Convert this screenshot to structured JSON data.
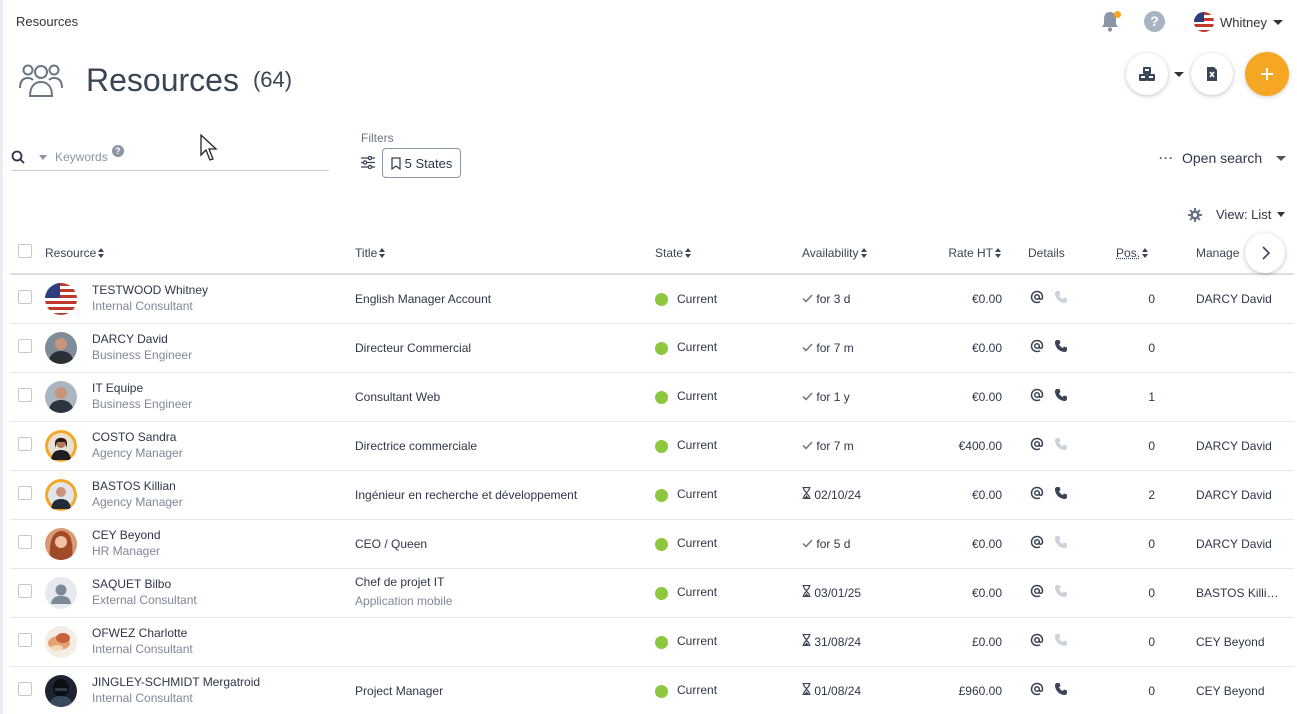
{
  "breadcrumb": "Resources",
  "user": {
    "name": "Whitney"
  },
  "page": {
    "title": "Resources",
    "count": "(64)"
  },
  "search": {
    "placeholder": "Keywords"
  },
  "filters": {
    "label": "Filters",
    "states_label": "5 States"
  },
  "open_search": "Open search",
  "view": {
    "label": "View: List"
  },
  "colors": {
    "accent": "#f5a623",
    "state_current": "#8dc63f"
  },
  "columns": [
    "Resource",
    "Title",
    "State",
    "Availability",
    "Rate HT",
    "Details",
    "Pos.",
    "Manage"
  ],
  "rows": [
    {
      "name": "TESTWOOD Whitney",
      "role": "Internal Consultant",
      "title": "English Manager Account",
      "title_sub": "",
      "state": "Current",
      "avail": "for 3 d",
      "avail_icon": "check-icon",
      "rate": "€0.00",
      "phone": false,
      "pos": "0",
      "manager": "DARCY David",
      "avatar": "flag"
    },
    {
      "name": "DARCY David",
      "role": "Business Engineer",
      "title": "Directeur Commercial",
      "title_sub": "",
      "state": "Current",
      "avail": "for 7 m",
      "avail_icon": "check-icon",
      "rate": "€0.00",
      "phone": true,
      "pos": "0",
      "manager": "",
      "avatar": "man-dark"
    },
    {
      "name": "IT Equipe",
      "role": "Business Engineer",
      "title": "Consultant Web",
      "title_sub": "",
      "state": "Current",
      "avail": "for 1 y",
      "avail_icon": "check-icon",
      "rate": "€0.00",
      "phone": true,
      "pos": "1",
      "manager": "",
      "avatar": "man-grey"
    },
    {
      "name": "COSTO Sandra",
      "role": "Agency Manager",
      "title": "Directrice commerciale",
      "title_sub": "",
      "state": "Current",
      "avail": "for 7 m",
      "avail_icon": "check-icon",
      "rate": "€400.00",
      "phone": false,
      "pos": "0",
      "manager": "DARCY David",
      "avatar": "woman-ring"
    },
    {
      "name": "BASTOS Killian",
      "role": "Agency Manager",
      "title": "Ingénieur en recherche et développement",
      "title_sub": "",
      "state": "Current",
      "avail": "02/10/24",
      "avail_icon": "hourglass-icon",
      "rate": "€0.00",
      "phone": true,
      "pos": "2",
      "manager": "DARCY David",
      "avatar": "man-ring"
    },
    {
      "name": "CEY Beyond",
      "role": "HR Manager",
      "title": "CEO / Queen",
      "title_sub": "",
      "state": "Current",
      "avail": "for 5 d",
      "avail_icon": "check-icon",
      "rate": "€0.00",
      "phone": false,
      "pos": "0",
      "manager": "DARCY David",
      "avatar": "woman-red"
    },
    {
      "name": "SAQUET Bilbo",
      "role": "External Consultant",
      "title": "Chef de projet IT",
      "title_sub": "Application mobile",
      "state": "Current",
      "avail": "03/01/25",
      "avail_icon": "hourglass-icon",
      "rate": "€0.00",
      "phone": false,
      "pos": "0",
      "manager": "BASTOS Killi…",
      "avatar": "placeholder"
    },
    {
      "name": "OFWEZ Charlotte",
      "role": "Internal Consultant",
      "title": "",
      "title_sub": "",
      "state": "Current",
      "avail": "31/08/24",
      "avail_icon": "hourglass-icon",
      "rate": "£0.00",
      "phone": false,
      "pos": "0",
      "manager": "CEY Beyond",
      "avatar": "food"
    },
    {
      "name": "JINGLEY-SCHMIDT Mergatroid",
      "role": "Internal Consultant",
      "title": "Project Manager",
      "title_sub": "",
      "state": "Current",
      "avail": "01/08/24",
      "avail_icon": "hourglass-icon",
      "rate": "£960.00",
      "phone": true,
      "pos": "0",
      "manager": "CEY Beyond",
      "avatar": "dark-helmet"
    }
  ]
}
